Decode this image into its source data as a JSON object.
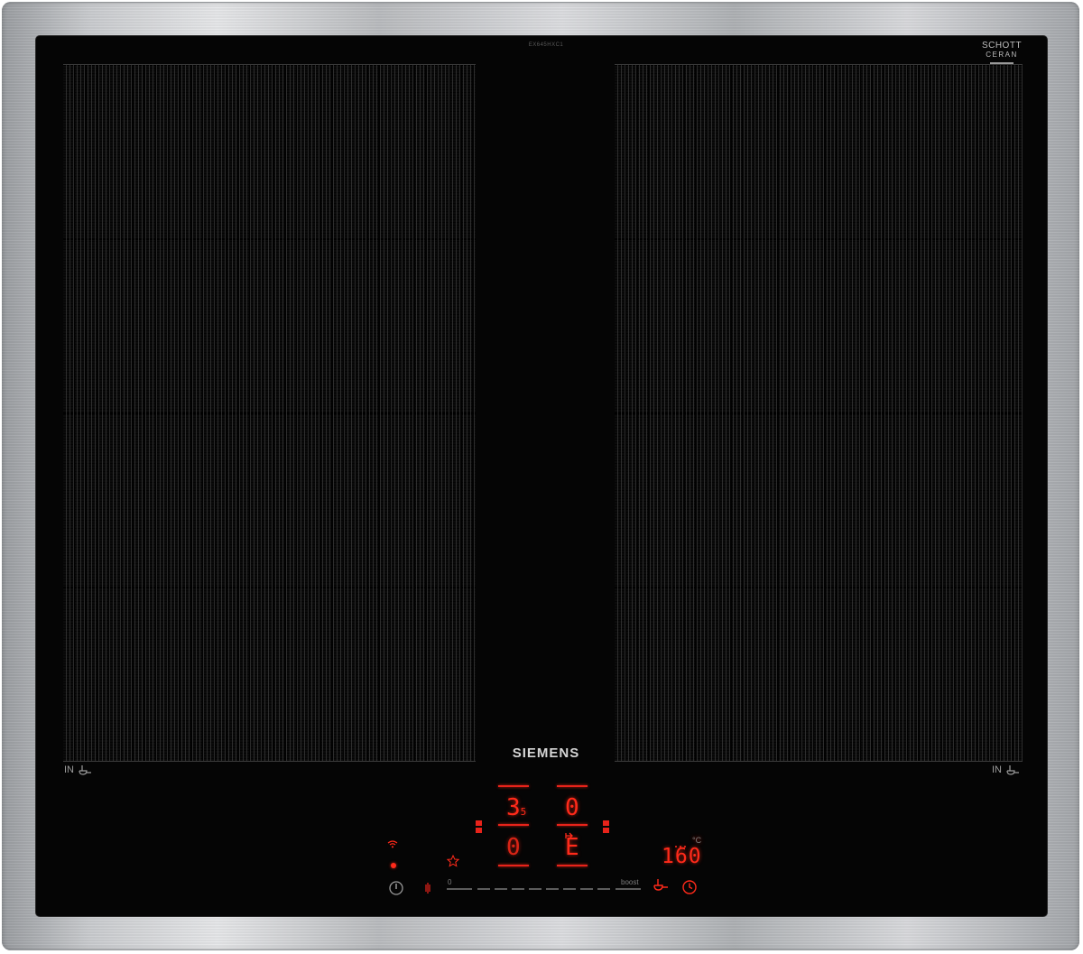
{
  "hob": {
    "brand": "SIEMENS",
    "model_code": "EX645HXC1",
    "glass_logo": {
      "line1": "SCHOTT",
      "line2": "CERAN"
    },
    "zone_label_left": "IN",
    "zone_label_right": "IN",
    "colors": {
      "glass": "#050505",
      "display_red": "#ff2a1a",
      "frame": "#c9cbce"
    }
  },
  "controls": {
    "zone_front_left_level": "3",
    "zone_front_left_decimal": "5",
    "zone_rear_left_level": "0",
    "zone_front_right_level": "0",
    "zone_rear_right_level": "E",
    "temperature_value": "160",
    "temperature_unit": "°C",
    "slider_start": "0",
    "slider_end": "boost",
    "icons": {
      "power": "power-icon",
      "wifi": "wifi-icon",
      "childlock": "childlock-icon",
      "favourite": "star-icon",
      "frying_sensor": "frying-sensor-icon",
      "timer": "timer-icon"
    }
  }
}
